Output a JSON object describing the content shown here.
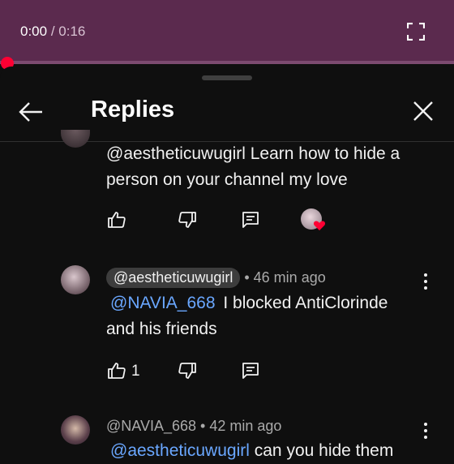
{
  "player": {
    "current_time": "0:00",
    "separator": "/",
    "duration": "0:16",
    "progress": 0.0,
    "progress_color": "#ff0033",
    "fullscreen_icon": "fullscreen-icon"
  },
  "header": {
    "title": "Replies",
    "back_icon": "arrow-left-icon",
    "close_icon": "close-icon"
  },
  "comments": [
    {
      "mention": "@aestheticuwugirl",
      "text_line1": "Learn how to hide a",
      "text_line2": "person on your channel my love",
      "like_count": "",
      "creator_heart": true
    },
    {
      "author": "@aestheticuwugirl",
      "time": "• 46 min ago",
      "mention": "@NAVIA_668",
      "text_line1": "I blocked AntiClorinde",
      "text_line2": "and his friends",
      "like_count": "1"
    },
    {
      "author": "@NAVIA_668",
      "time": "• 42 min ago",
      "mention": "@aestheticuwugirl",
      "text_line1": "can you hide them"
    }
  ],
  "colors": {
    "player_bg": "#5b2a4e",
    "background": "#0f0f0f",
    "mention": "#6aa7ff",
    "author_chip": "#3d3d3d"
  }
}
